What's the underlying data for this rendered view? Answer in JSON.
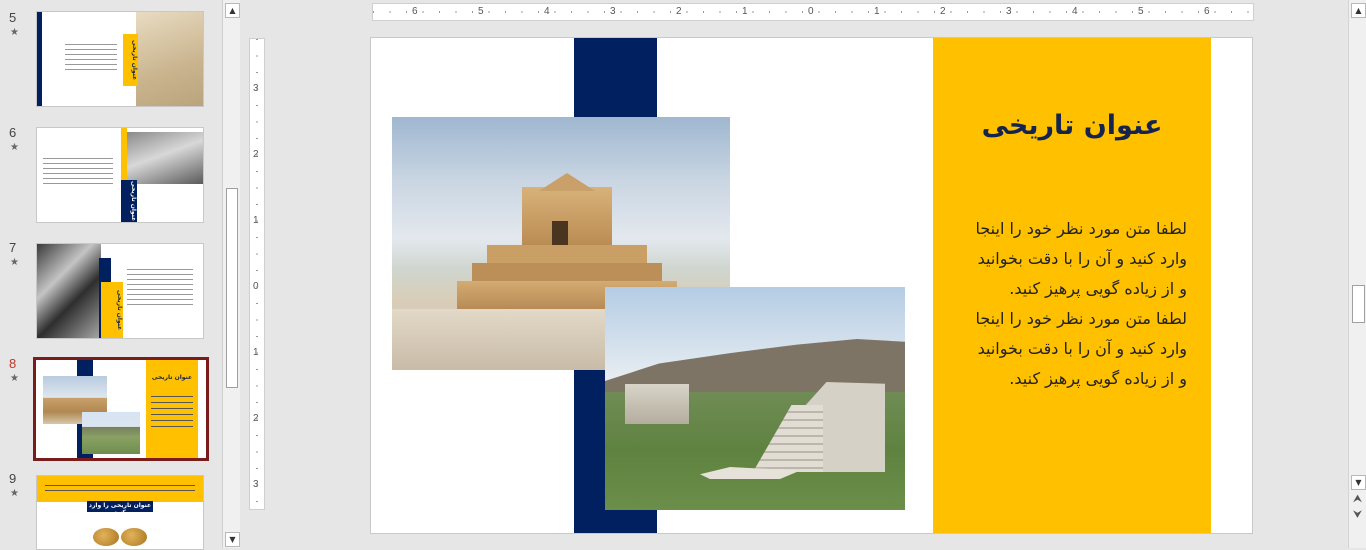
{
  "thumbnails": [
    {
      "number": "5",
      "star": "★",
      "title": "عنوان تاریخی"
    },
    {
      "number": "6",
      "star": "★",
      "title": "عنوان تاریخی"
    },
    {
      "number": "7",
      "star": "★",
      "title": "عنوان تاریخی"
    },
    {
      "number": "8",
      "star": "★",
      "title": "عنوان تاریخی"
    },
    {
      "number": "9",
      "star": "★",
      "title": "عنوان تاریخی را وارد کنید"
    }
  ],
  "ruler": {
    "horizontal_labels": [
      "6",
      "5",
      "4",
      "3",
      "2",
      "1",
      "0",
      "1",
      "2",
      "3",
      "4",
      "5",
      "6"
    ],
    "vertical_labels": [
      "3",
      "2",
      "1",
      "0",
      "1",
      "2",
      "3"
    ]
  },
  "slide": {
    "title": "عنوان تاریخی",
    "body": "لطفا متن مورد نظر خود را اینجا\nوارد کنید و آن را با دقت بخوانید\nو از زیاده گویی پرهیز کنید.\nلطفا متن مورد نظر خود را اینجا\nوارد کنید و آن را با دقت بخوانید\nو از زیاده گویی پرهیز کنید.",
    "colors": {
      "title_box": "#ffc000",
      "navy_bar": "#002060",
      "title_text": "#14244e"
    }
  },
  "icons": {
    "scroll_up": "▲",
    "scroll_down": "▼",
    "prev_slide": "⮝",
    "next_slide": "⮟"
  }
}
